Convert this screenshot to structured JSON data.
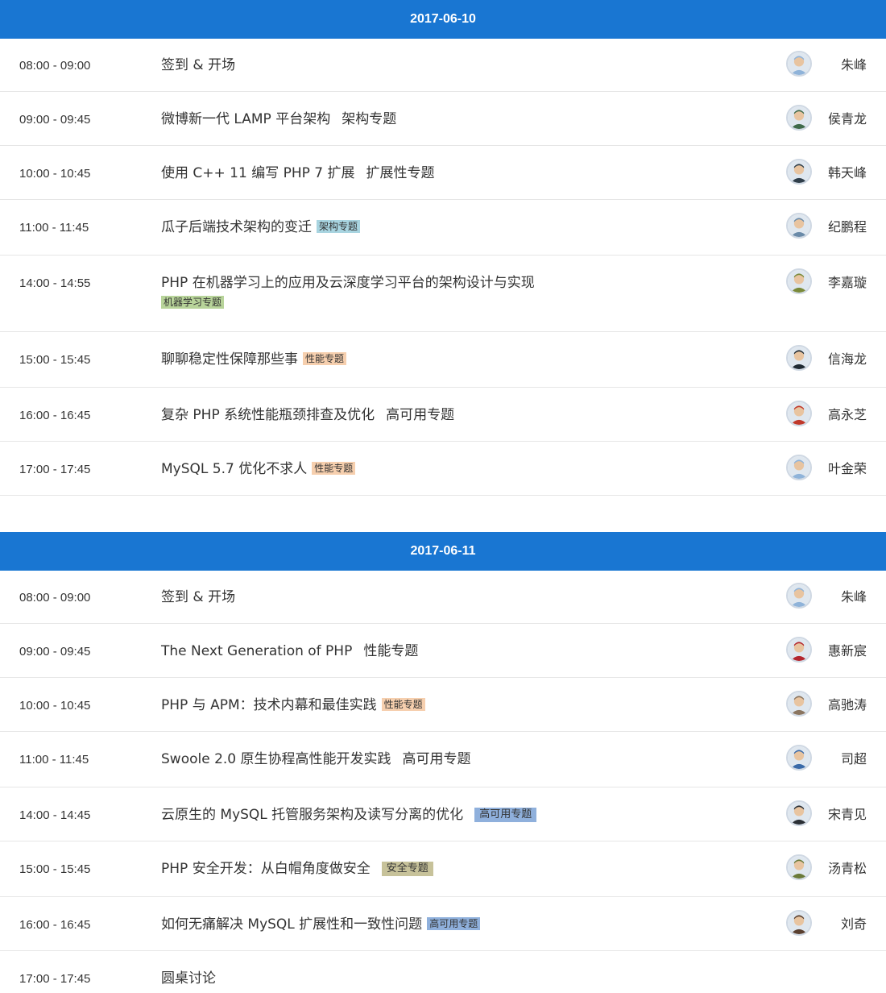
{
  "days": [
    {
      "date": "2017-06-10",
      "sessions": [
        {
          "time": "08:00 - 09:00",
          "title": "签到 & 开场",
          "tag": "",
          "tag_style": "none",
          "speaker": "朱峰",
          "avatar_color": "#8fb3d9"
        },
        {
          "time": "09:00 - 09:45",
          "title": "微博新一代 LAMP 平台架构",
          "tag": "架构专题",
          "tag_style": "plain",
          "speaker": "侯青龙",
          "avatar_color": "#3f6a4a"
        },
        {
          "time": "10:00 - 10:45",
          "title": "使用 C++ 11 编写 PHP 7 扩展",
          "tag": "扩展性专题",
          "tag_style": "plain",
          "speaker": "韩天峰",
          "avatar_color": "#2f3e4a"
        },
        {
          "time": "11:00 - 11:45",
          "title": "瓜子后端技术架构的变迁",
          "tag": "架构专题",
          "tag_style": "badge",
          "tag_color": "#a8d4e0",
          "speaker": "纪鹏程",
          "avatar_color": "#6a8aa8"
        },
        {
          "time": "14:00 - 14:55",
          "title": "PHP 在机器学习上的应用及云深度学习平台的架构设计与实现",
          "tag": "机器学习专题",
          "tag_style": "badge-newline",
          "tag_color": "#b8d49a",
          "speaker": "李嘉璇",
          "avatar_color": "#7a8a3a"
        },
        {
          "time": "15:00 - 15:45",
          "title": "聊聊稳定性保障那些事",
          "tag": "性能专题",
          "tag_style": "badge",
          "tag_color": "#f6cfae",
          "speaker": "信海龙",
          "avatar_color": "#1f2a33"
        },
        {
          "time": "16:00 - 16:45",
          "title": " 复杂 PHP 系统性能瓶颈排查及优化",
          "tag": "高可用专题",
          "tag_style": "plain",
          "speaker": "高永芝",
          "avatar_color": "#c0392b"
        },
        {
          "time": "17:00 - 17:45",
          "title": "MySQL 5.7 优化不求人",
          "tag": "性能专题",
          "tag_style": "badge",
          "tag_color": "#f6cfae",
          "speaker": "叶金荣",
          "avatar_color": "#8fb3d9"
        }
      ]
    },
    {
      "date": "2017-06-11",
      "sessions": [
        {
          "time": "08:00 - 09:00",
          "title": "签到 & 开场",
          "tag": "",
          "tag_style": "none",
          "speaker": "朱峰",
          "avatar_color": "#8fb3d9"
        },
        {
          "time": "09:00 - 09:45",
          "title": "The Next Generation of PHP",
          "tag": "性能专题",
          "tag_style": "plain",
          "speaker": "惠新宸",
          "avatar_color": "#b3262e"
        },
        {
          "time": "10:00 - 10:45",
          "title": "PHP 与 APM：技术内幕和最佳实践",
          "tag": "性能专题",
          "tag_style": "badge",
          "tag_color": "#f6cfae",
          "speaker": "高驰涛",
          "avatar_color": "#8a7560"
        },
        {
          "time": "11:00 - 11:45",
          "title": "Swoole 2.0 原生协程高性能开发实践",
          "tag": "高可用专题",
          "tag_style": "plain",
          "speaker": "司超",
          "avatar_color": "#3a6aa8"
        },
        {
          "time": "14:00 - 14:45",
          "title": "云原生的 MySQL 托管服务架构及读写分离的优化",
          "tag": "高可用专题",
          "tag_style": "badge-wide",
          "tag_color": "#8fb0dc",
          "speaker": "宋青见",
          "avatar_color": "#2a2f35"
        },
        {
          "time": "15:00 - 15:45",
          "title": "PHP 安全开发：从白帽角度做安全",
          "tag": "安全专题",
          "tag_style": "badge-wide",
          "tag_color": "#c7c29a",
          "speaker": "汤青松",
          "avatar_color": "#6a7a3a"
        },
        {
          "time": "16:00 - 16:45",
          "title": "如何无痛解决 MySQL 扩展性和一致性问题",
          "tag": "高可用专题",
          "tag_style": "badge",
          "tag_color": "#8fb0dc",
          "speaker": "刘奇",
          "avatar_color": "#5a4030"
        },
        {
          "time": "17:00 - 17:45",
          "title": "圆桌讨论",
          "tag": "",
          "tag_style": "none",
          "speaker": "",
          "avatar_color": ""
        }
      ]
    }
  ]
}
